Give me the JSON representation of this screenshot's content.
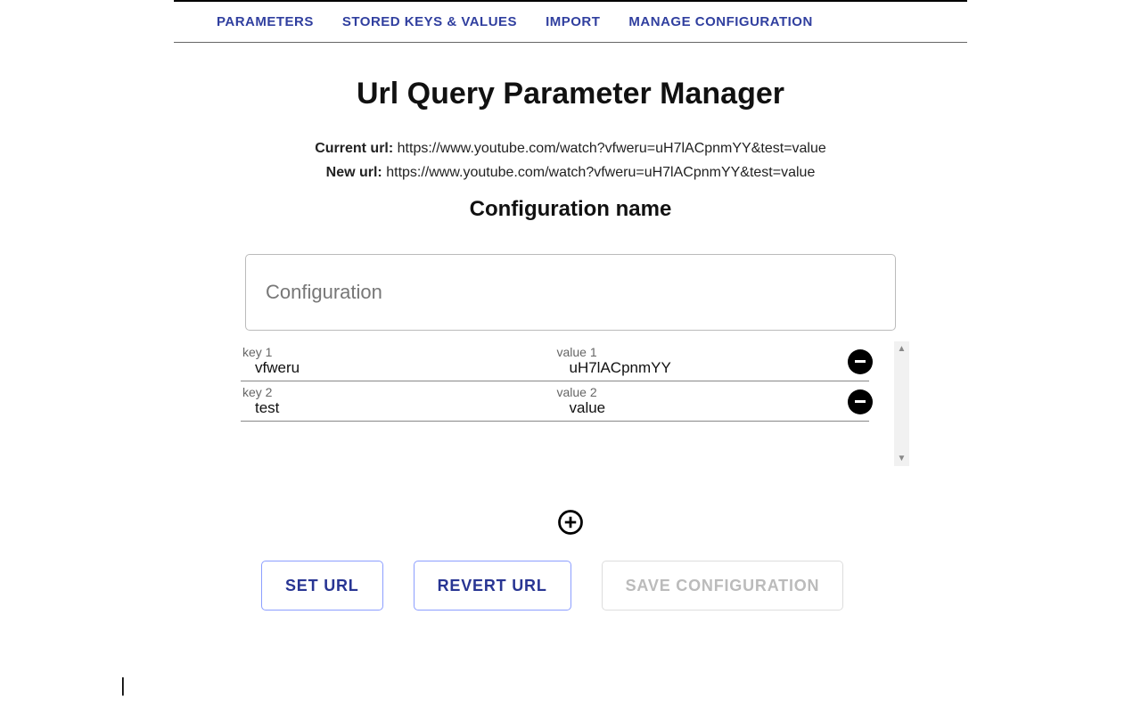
{
  "tabs": {
    "parameters": "PARAMETERS",
    "stored": "STORED KEYS & VALUES",
    "import": "IMPORT",
    "manage": "MANAGE CONFIGURATION"
  },
  "title": "Url Query Parameter Manager",
  "urls": {
    "current_label": "Current url:",
    "current_value": "https://www.youtube.com/watch?vfweru=uH7lACpnmYY&test=value",
    "new_label": "New url:",
    "new_value": "https://www.youtube.com/watch?vfweru=uH7lACpnmYY&test=value"
  },
  "config": {
    "heading": "Configuration name",
    "placeholder": "Configuration",
    "value": ""
  },
  "params": [
    {
      "key_label": "key 1",
      "key": "vfweru",
      "value_label": "value 1",
      "value": "uH7lACpnmYY"
    },
    {
      "key_label": "key 2",
      "key": "test",
      "value_label": "value 2",
      "value": "value"
    }
  ],
  "buttons": {
    "set": "SET URL",
    "revert": "REVERT URL",
    "save": "SAVE CONFIGURATION"
  }
}
